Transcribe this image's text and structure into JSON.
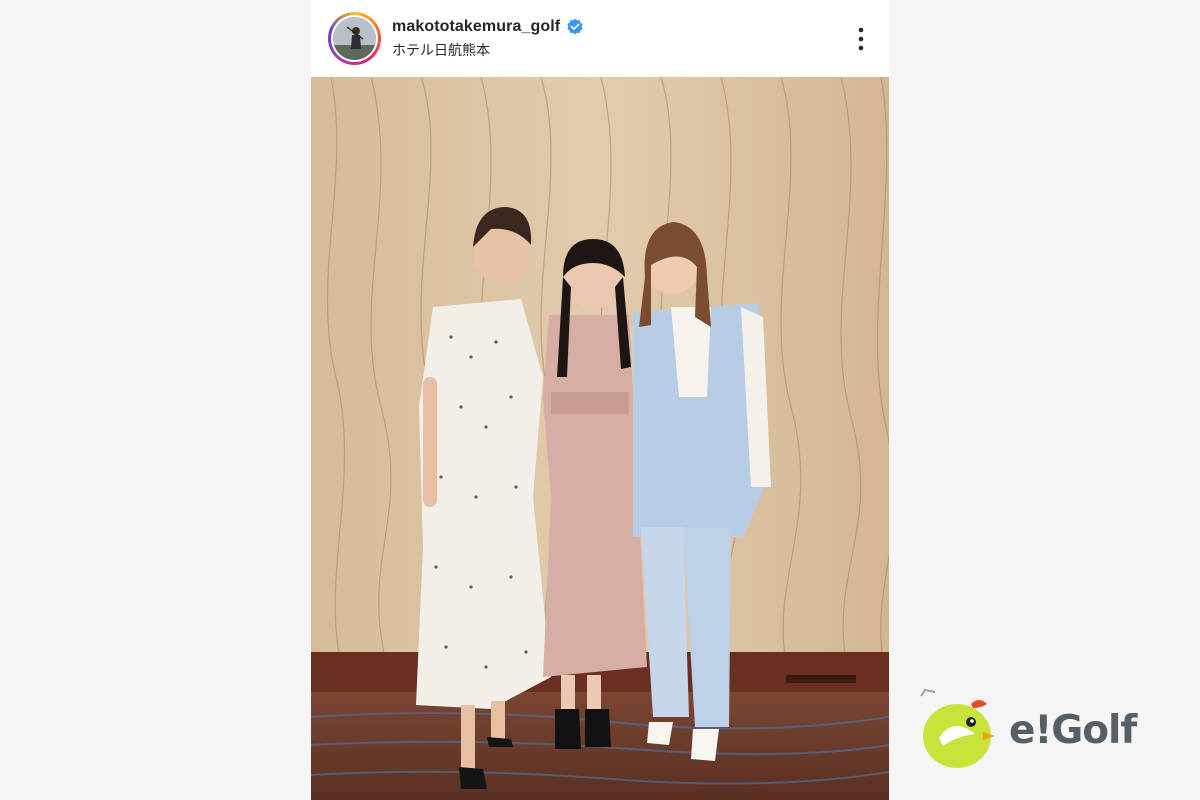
{
  "post": {
    "username": "makototakemura_golf",
    "location": "ホテル日航熊本",
    "verified": true,
    "icons": {
      "verified": "verified-badge-icon",
      "more": "more-options-icon"
    },
    "colors": {
      "verified": "#3897f0",
      "wall": "#d8bfa0",
      "carpet": "#6a3a2a"
    }
  },
  "watermark": {
    "brand": "e!Golf",
    "mascot_icon": "mascot-icon"
  }
}
